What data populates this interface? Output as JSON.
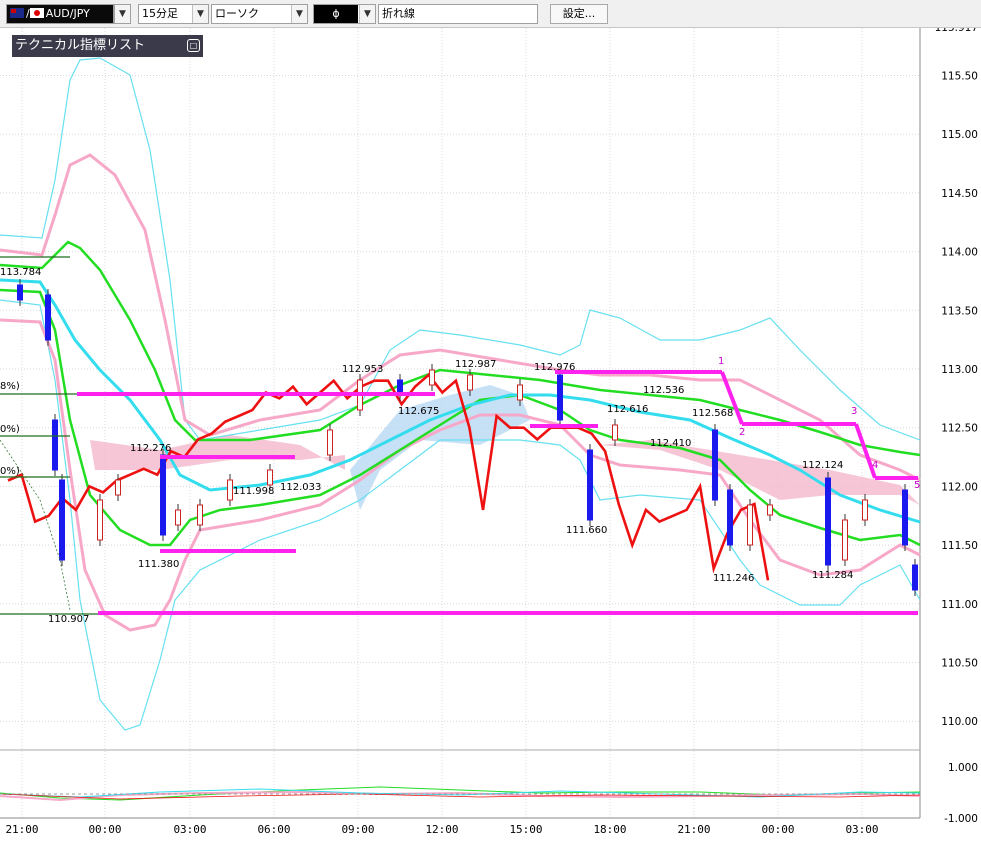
{
  "toolbar": {
    "pair": "AUD/JPY",
    "timeframe": "15分足",
    "chart_type": "ローソク",
    "indicator_code": "ɸ",
    "line_type": "折れ線",
    "settings_button": "設定..."
  },
  "panel": {
    "title": "テクニカル指標リスト",
    "button": "□"
  },
  "chart_data": {
    "type": "line",
    "y_ticks": [
      "115.50",
      "115.00",
      "114.50",
      "114.00",
      "113.50",
      "113.00",
      "112.50",
      "112.00",
      "111.50",
      "111.00",
      "110.50",
      "110.00"
    ],
    "y_top_partial": "115.917",
    "ylim": [
      109.5,
      116.0
    ],
    "x_ticks": [
      "21:00",
      "00:00",
      "03:00",
      "06:00",
      "09:00",
      "12:00",
      "15:00",
      "18:00",
      "21:00",
      "00:00",
      "03:00"
    ],
    "annotations": [
      "112.953",
      "112.987",
      "112.976",
      "112.536",
      "112.616",
      "112.568",
      "112.410",
      "112.276",
      "111.998",
      "112.033",
      "112.675",
      "111.660",
      "111.380",
      "111.246",
      "112.124",
      "111.284",
      "113.784",
      "110.907"
    ],
    "partial_labels": [
      "8%)",
      "0%)",
      "0%)"
    ],
    "wave_numbers": [
      "1",
      "2",
      "3",
      "4",
      "5"
    ],
    "oscillator": {
      "ticks": [
        "1.000",
        "-1.000"
      ]
    },
    "series": [
      {
        "values": [
          112.05,
          112.1,
          111.7,
          111.75,
          111.9,
          111.8,
          112.0,
          111.95,
          112.05,
          112.1,
          112.15,
          112.1,
          112.3,
          112.25,
          112.4,
          112.45,
          112.55,
          112.6,
          112.65,
          112.8,
          112.75,
          112.85,
          112.7,
          112.8,
          112.9,
          112.75,
          112.85,
          112.9,
          112.9,
          112.7,
          112.85,
          112.95,
          112.8,
          112.9,
          112.5,
          111.8,
          112.6,
          112.5,
          112.5,
          112.4,
          112.5,
          112.5,
          112.5,
          112.45,
          112.3,
          111.85,
          111.5,
          111.8,
          111.7,
          111.75,
          111.8,
          112.0,
          111.3,
          111.6,
          111.8,
          111.85,
          111.2
        ]
      }
    ]
  }
}
